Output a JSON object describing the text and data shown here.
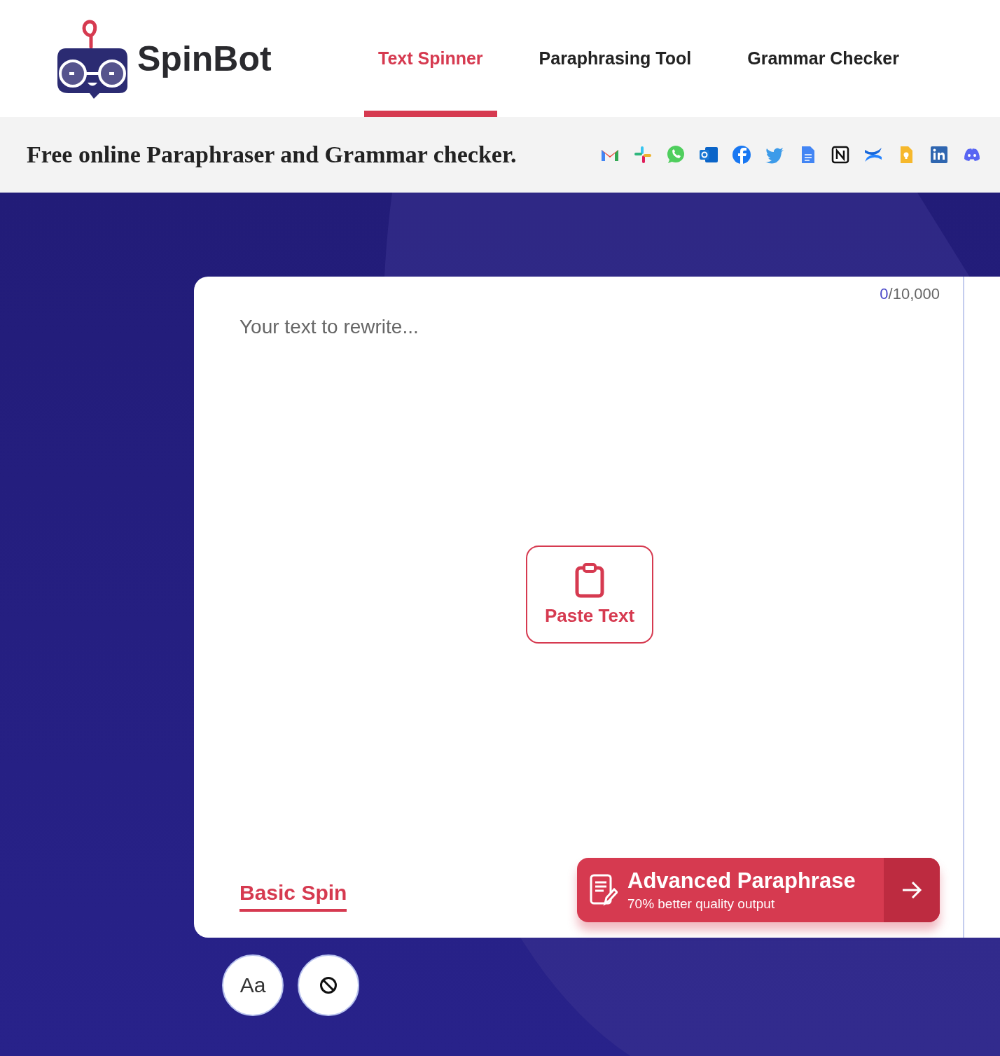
{
  "brand": {
    "name": "SpinBot"
  },
  "nav": [
    {
      "label": "Text Spinner",
      "selected": true
    },
    {
      "label": "Paraphrasing Tool",
      "selected": false
    },
    {
      "label": "Grammar Checker",
      "selected": false
    }
  ],
  "tagline": "Free online Paraphraser and Grammar checker.",
  "integrations": [
    {
      "kind": "mail"
    },
    {
      "kind": "hash"
    },
    {
      "kind": "chat"
    },
    {
      "kind": "outlook"
    },
    {
      "kind": "fb"
    },
    {
      "kind": "bird"
    },
    {
      "kind": "doc"
    },
    {
      "kind": "notion"
    },
    {
      "kind": "cross"
    },
    {
      "kind": "bulb"
    },
    {
      "kind": "in"
    },
    {
      "kind": "game"
    }
  ],
  "editor": {
    "count": "0",
    "limit": "/10,000",
    "placeholder": "Your text to rewrite...",
    "paste_button": "Paste Text"
  },
  "modes": [
    {
      "label": "Basic Spin",
      "selected": true
    }
  ],
  "advanced": {
    "title": "Advanced Paraphrase",
    "subtitle": "70% better quality output"
  },
  "tools": [
    {
      "kind": "font",
      "label": "Aa"
    },
    {
      "kind": "clear"
    }
  ]
}
